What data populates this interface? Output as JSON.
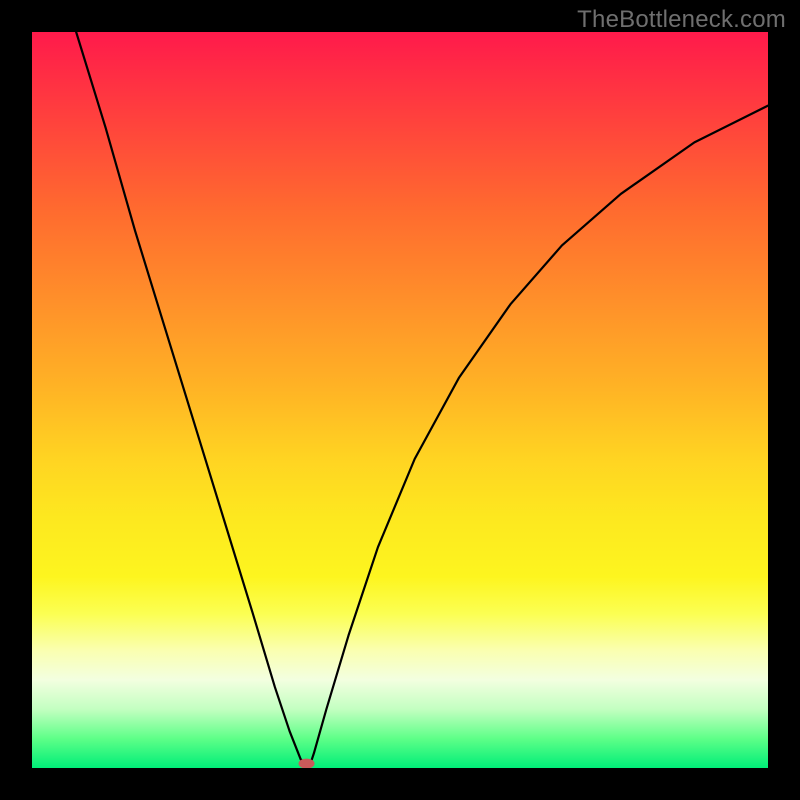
{
  "watermark": "TheBottleneck.com",
  "chart_data": {
    "type": "line",
    "title": "",
    "xlabel": "",
    "ylabel": "",
    "xlim": [
      0,
      100
    ],
    "ylim": [
      0,
      100
    ],
    "grid": false,
    "legend": false,
    "series": [
      {
        "name": "bottleneck-curve",
        "x": [
          6,
          10,
          14,
          18,
          22,
          26,
          30,
          33,
          35,
          36.5,
          37.2,
          37.8,
          38.3,
          40,
          43,
          47,
          52,
          58,
          65,
          72,
          80,
          90,
          100
        ],
        "y": [
          100,
          87,
          73,
          60,
          47,
          34,
          21,
          11,
          5,
          1.2,
          0.5,
          0.5,
          2,
          8,
          18,
          30,
          42,
          53,
          63,
          71,
          78,
          85,
          90
        ]
      }
    ],
    "marker": {
      "name": "optimal-point",
      "x": 37.3,
      "y": 0.6,
      "color": "#c95a5a",
      "rx": 8,
      "ry": 5
    }
  }
}
